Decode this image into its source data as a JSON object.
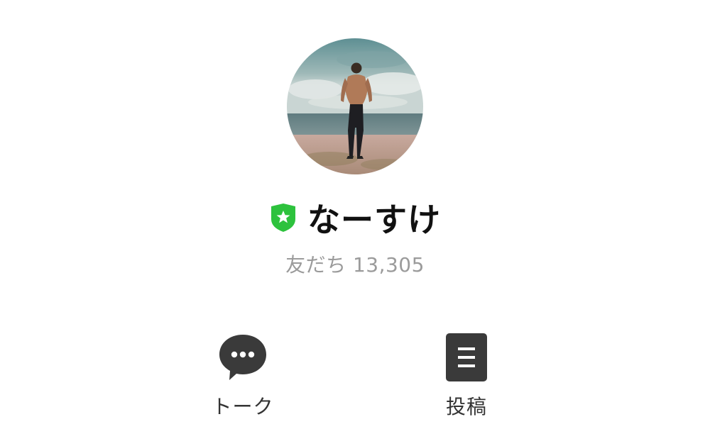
{
  "profile": {
    "name": "なーすけ",
    "friends_label": "友だち 13,305",
    "badge_icon": "verified-shield-star-icon",
    "badge_color": "#2dc23d"
  },
  "actions": [
    {
      "label": "トーク",
      "icon": "chat-bubble-icon"
    },
    {
      "label": "投稿",
      "icon": "post-document-icon"
    }
  ],
  "colors": {
    "icon_dark": "#3a3a3a",
    "friends_text": "#9b9b9b"
  }
}
